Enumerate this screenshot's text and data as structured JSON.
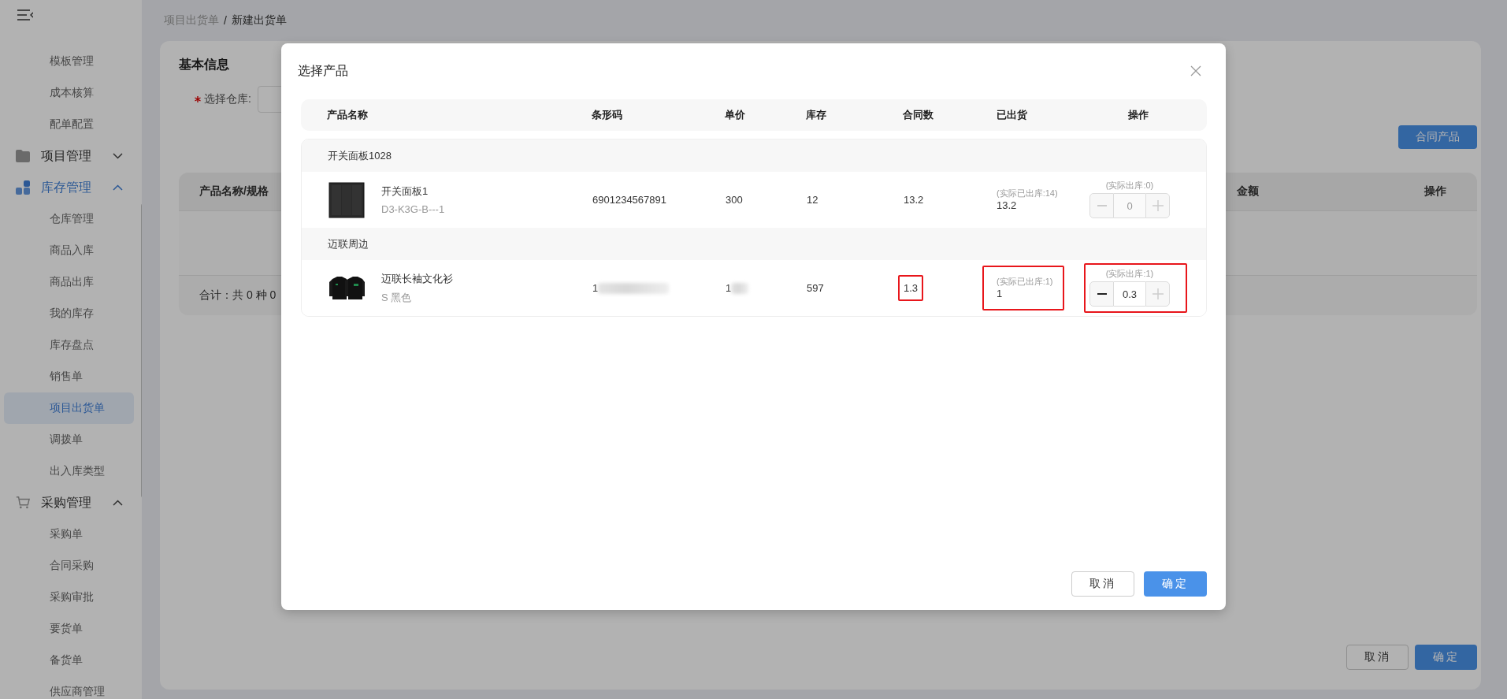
{
  "sidebar": {
    "items": [
      {
        "kind": "item",
        "label": "模板管理",
        "selected": false
      },
      {
        "kind": "item",
        "label": "成本核算",
        "selected": false
      },
      {
        "kind": "item",
        "label": "配单配置",
        "selected": false
      },
      {
        "kind": "group",
        "label": "项目管理",
        "expanded": false,
        "active": false
      },
      {
        "kind": "group",
        "label": "库存管理",
        "expanded": true,
        "active": true,
        "children": [
          {
            "label": "仓库管理",
            "selected": false
          },
          {
            "label": "商品入库",
            "selected": false
          },
          {
            "label": "商品出库",
            "selected": false
          },
          {
            "label": "我的库存",
            "selected": false
          },
          {
            "label": "库存盘点",
            "selected": false
          },
          {
            "label": "销售单",
            "selected": false
          },
          {
            "label": "项目出货单",
            "selected": true
          },
          {
            "label": "调拨单",
            "selected": false
          },
          {
            "label": "出入库类型",
            "selected": false
          }
        ]
      },
      {
        "kind": "group",
        "label": "采购管理",
        "expanded": true,
        "active": false,
        "children": [
          {
            "label": "采购单",
            "selected": false
          },
          {
            "label": "合同采购",
            "selected": false
          },
          {
            "label": "采购审批",
            "selected": false
          },
          {
            "label": "要货单",
            "selected": false
          },
          {
            "label": "备货单",
            "selected": false
          },
          {
            "label": "供应商管理",
            "selected": false
          }
        ]
      }
    ]
  },
  "breadcrumb": {
    "parent": "项目出货单",
    "separator": "/",
    "current": "新建出货单"
  },
  "form": {
    "section_title": "基本信息",
    "fields": [
      {
        "label": "选择仓库:",
        "required": true
      }
    ]
  },
  "contract_button": "合同产品",
  "main_table": {
    "columns": [
      "产品名称/规格",
      "金额",
      "操作"
    ],
    "footer": "合计：共 0 种 0"
  },
  "actions": [
    "取消",
    "确定"
  ],
  "dialog": {
    "title": "选择产品",
    "columns": [
      "产品名称",
      "条形码",
      "单价",
      "库存",
      "合同数",
      "已出货",
      "操作"
    ],
    "groups": [
      {
        "name": "开关面板1028",
        "products": [
          {
            "kind": "panel",
            "name": "开关面板1",
            "spec": "D3-K3G-B---1",
            "barcode": "6901234567891",
            "barcode_blurred": false,
            "price": "300",
            "price_blurred": false,
            "stock": "12",
            "contract_qty": "13.2",
            "contract_highlighted": false,
            "shipped_note": "(实际已出库:14)",
            "shipped": "13.2",
            "shipped_highlighted": false,
            "op_note": "(实际出库:0)",
            "quantity": "0",
            "minus_disabled": true,
            "plus_disabled": true,
            "op_highlighted": false
          }
        ]
      },
      {
        "name": "迈联周边",
        "products": [
          {
            "kind": "apparel",
            "name": "迈联长袖文化衫",
            "spec": "S 黑色",
            "barcode": "1",
            "barcode_blurred": true,
            "price": "1",
            "price_blurred": true,
            "stock": "597",
            "contract_qty": "1.3",
            "contract_highlighted": true,
            "shipped_note": "(实际已出库:1)",
            "shipped": "1",
            "shipped_highlighted": true,
            "op_note": "(实际出库:1)",
            "quantity": "0.3",
            "minus_disabled": false,
            "plus_disabled": true,
            "op_highlighted": true
          }
        ]
      }
    ],
    "buttons": [
      {
        "label": "取消",
        "kind": "secondary"
      },
      {
        "label": "确定",
        "kind": "primary"
      }
    ]
  }
}
